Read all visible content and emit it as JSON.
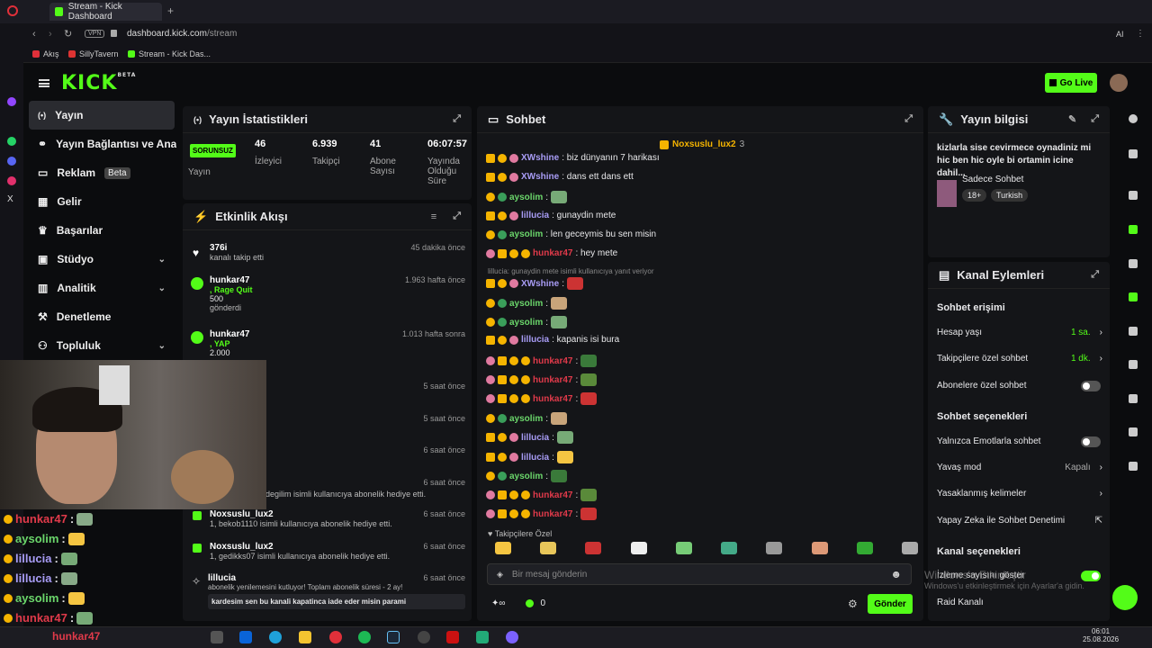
{
  "browser": {
    "tab_title": "Stream - Kick Dashboard",
    "url_domain": "dashboard.kick.com",
    "url_path": "/stream",
    "vpn": "VPN",
    "bookmarks": [
      "Akış",
      "SillyTavern",
      "Stream - Kick Das..."
    ],
    "ai_label": "AI"
  },
  "header": {
    "logo": "KICK",
    "logo_sup": "BETA",
    "go_live": "Go Live"
  },
  "nav": [
    {
      "label": "Yayın",
      "active": true
    },
    {
      "label": "Yayın Bağlantısı ve Anahtarı"
    },
    {
      "label": "Reklam",
      "badge": "Beta"
    },
    {
      "label": "Gelir"
    },
    {
      "label": "Başarılar"
    },
    {
      "label": "Stüdyo",
      "chevron": true
    },
    {
      "label": "Analitik",
      "chevron": true
    },
    {
      "label": "Denetleme"
    },
    {
      "label": "Topluluk",
      "chevron": true
    }
  ],
  "stats": {
    "title": "Yayın İstatistikleri",
    "status": "SORUNSUZ",
    "status_label": "Yayın",
    "viewers": "46",
    "viewers_label": "İzleyici",
    "followers": "6.939",
    "followers_label": "Takipçi",
    "subs": "41",
    "subs_label": "Abone Sayısı",
    "uptime": "06:07:57",
    "uptime_label": "Yayında Olduğu Süre"
  },
  "activity": {
    "title": "Etkinlik Akışı",
    "events": [
      {
        "name": "376i",
        "desc": "kanalı takip etti",
        "time": "45 dakika önce"
      },
      {
        "name": "hunkar47",
        "desc": ", Rage Quit",
        "amount": "500",
        "desc2": "gönderdi",
        "time": "1.963 hafta önce"
      },
      {
        "name": "hunkar47",
        "desc": ", YAP",
        "amount": "2.000",
        "time": "1.013 hafta sonra"
      },
      {
        "time": "5 saat önce"
      },
      {
        "time": "5 saat önce"
      },
      {
        "time": "6 saat önce"
      },
      {
        "name": "",
        "desc": "degilim isimli kullanıcıya abonelik hediye etti.",
        "time": "6 saat önce"
      },
      {
        "name": "Noxsuslu_lux2",
        "desc": "1, bekob1110 isimli kullanıcıya abonelik hediye etti.",
        "time": "6 saat önce"
      },
      {
        "name": "Noxsuslu_lux2",
        "desc": "1, gedikks07 isimli kullanıcıya abonelik hediye etti.",
        "time": "6 saat önce"
      },
      {
        "name": "lillucia",
        "desc": "abonelik yenilemesini kutluyor! Toplam abonelik süresi - 2 ay!",
        "time": "6 saat önce",
        "msg": "kardesim sen bu kanali kapatinca iade eder misin parami"
      }
    ]
  },
  "chat": {
    "title": "Sohbet",
    "pinned_user": "Noxsuslu_lux2",
    "pinned_count": "3",
    "reply_note": "lillucia: gunaydin mete isimli kullanıcıya yanıt veriyor",
    "messages": [
      {
        "user": "XWshine",
        "cls": "u-lav",
        "text": ": biz dünyanın 7 harikası"
      },
      {
        "user": "XWshine",
        "cls": "u-lav",
        "text": ": dans ett dans ett"
      },
      {
        "user": "aysolim",
        "cls": "u-green",
        "text": ":"
      },
      {
        "user": "lillucia",
        "cls": "u-lav",
        "text": ": gunaydin mete"
      },
      {
        "user": "aysolim",
        "cls": "u-green",
        "text": ": len geceymis bu sen misin"
      },
      {
        "user": "hunkar47",
        "cls": "u-red",
        "text": ": hey mete"
      },
      {
        "user": "XWshine",
        "cls": "u-lav",
        "text": ":"
      },
      {
        "user": "aysolim",
        "cls": "u-green",
        "text": ":"
      },
      {
        "user": "aysolim",
        "cls": "u-green",
        "text": ":"
      },
      {
        "user": "lillucia",
        "cls": "u-lav",
        "text": ": kapanis isi bura"
      },
      {
        "user": "hunkar47",
        "cls": "u-red",
        "text": ":"
      },
      {
        "user": "hunkar47",
        "cls": "u-red",
        "text": ":"
      },
      {
        "user": "hunkar47",
        "cls": "u-red",
        "text": ":"
      },
      {
        "user": "aysolim",
        "cls": "u-green",
        "text": ":"
      },
      {
        "user": "lillucia",
        "cls": "u-lav",
        "text": ":"
      },
      {
        "user": "lillucia",
        "cls": "u-lav",
        "text": ":"
      },
      {
        "user": "aysolim",
        "cls": "u-green",
        "text": ":"
      },
      {
        "user": "hunkar47",
        "cls": "u-red",
        "text": ":"
      },
      {
        "user": "hunkar47",
        "cls": "u-red",
        "text": ":"
      }
    ],
    "followers_only": "Takipçilere Özel",
    "placeholder": "Bir mesaj gönderin",
    "points": "0",
    "send": "Gönder"
  },
  "info": {
    "title": "Yayın bilgisi",
    "stream_title": "kizlarla sise cevirmece oynadiniz mi hic ben hic oyle bi ortamin icine dahil...",
    "category": "Sadece Sohbet",
    "tags": [
      "18+",
      "Turkish"
    ]
  },
  "actions": {
    "title": "Kanal Eylemleri",
    "access": "Sohbet erişimi",
    "account_age": "Hesap yaşı",
    "account_age_val": "1 sa.",
    "follower_chat": "Takipçilere özel sohbet",
    "follower_chat_val": "1 dk.",
    "sub_chat": "Abonelere özel sohbet",
    "options": "Sohbet seçenekleri",
    "emote_only": "Yalnızca Emotlarla sohbet",
    "slow": "Yavaş mod",
    "slow_val": "Kapalı",
    "banned": "Yasaklanmış kelimeler",
    "ai_mod": "Yapay Zeka ile Sohbet Denetimi",
    "channel_options": "Kanal seçenekleri",
    "show_viewers": "İzleme sayısını göster",
    "raid": "Raid Kanalı"
  },
  "watermark": {
    "line1": "Windows'u Etkinleştir",
    "line2": "Windows'u etkinleştirmek için Ayarlar'a gidin."
  },
  "overlay_chat": [
    {
      "user": "hunkar47",
      "cls": "u-red"
    },
    {
      "user": "aysolim",
      "cls": "u-green"
    },
    {
      "user": "lillucia",
      "cls": "u-lav"
    },
    {
      "user": "lillucia",
      "cls": "u-lav"
    },
    {
      "user": "aysolim",
      "cls": "u-green"
    },
    {
      "user": "hunkar47",
      "cls": "u-red"
    }
  ],
  "overlay_bottom": "hunkar47",
  "clock": {
    "time": "06:01",
    "date": "25.08.2026"
  },
  "colors": {
    "accent": "#53fc18",
    "panel": "#141518",
    "bg": "#0b0c0e"
  }
}
